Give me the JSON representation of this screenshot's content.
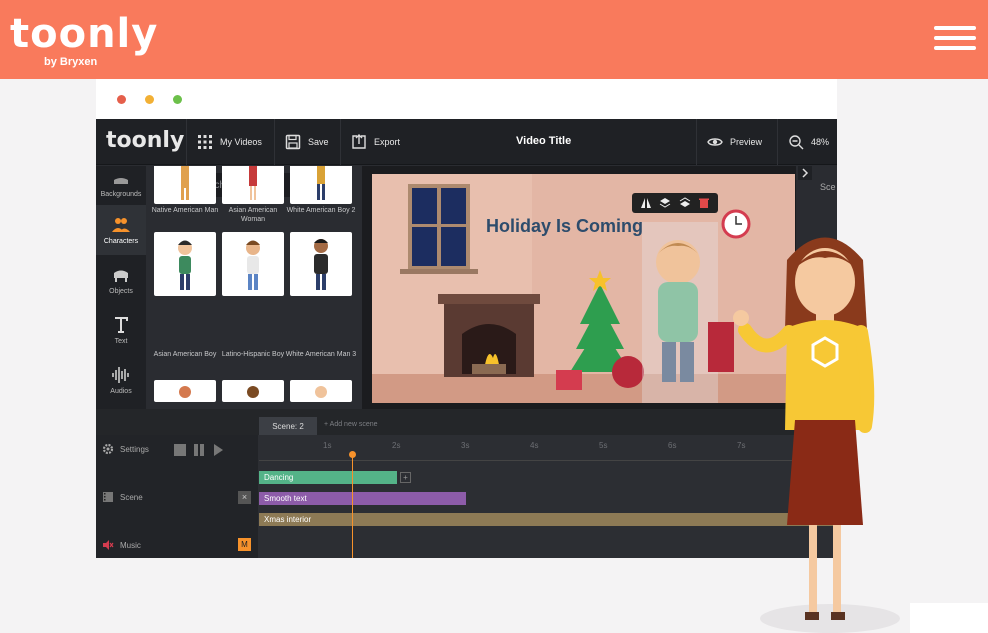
{
  "header": {
    "brand": "toonly",
    "brand_sub": "by Bryxen",
    "menu_icon": "hamburger-menu-icon"
  },
  "colors": {
    "header_bg": "#f97a5c",
    "dot_red": "#e55f4b",
    "dot_yellow": "#f2b035",
    "dot_green": "#6cc04a",
    "track_dancing": "#54b388",
    "track_smooth_text": "#8d5ca9",
    "track_xmas": "#8d7a55",
    "playhead": "#f7922b"
  },
  "app": {
    "logo": "toonly",
    "toolbar": {
      "my_videos": "My Videos",
      "save": "Save",
      "export": "Export",
      "video_title": "Video Title",
      "preview": "Preview",
      "zoom": "48%"
    },
    "sidebar": [
      {
        "label": "Backgrounds",
        "icon": "backgrounds-icon"
      },
      {
        "label": "Characters",
        "icon": "characters-icon"
      },
      {
        "label": "Objects",
        "icon": "objects-icon"
      },
      {
        "label": "Text",
        "icon": "text-icon"
      },
      {
        "label": "Audios",
        "icon": "audios-icon"
      }
    ],
    "search": {
      "placeholder": "Search characters..."
    },
    "characters": [
      {
        "label": "Native American Man"
      },
      {
        "label": "Asian American Woman"
      },
      {
        "label": "White American Boy 2"
      },
      {
        "label": "Asian American Boy"
      },
      {
        "label": "Latino-Hispanic Boy"
      },
      {
        "label": "White American Man 3"
      }
    ],
    "canvas_text": "Holiday Is Coming",
    "right_panel_label": "Sce",
    "timeline": {
      "scene_tab": "Scene: 2",
      "add_scene": "Add new scene",
      "settings": "Settings",
      "scene": "Scene",
      "music": "Music",
      "music_badge": "M",
      "ticks": [
        "1s",
        "2s",
        "3s",
        "4s",
        "5s",
        "6s",
        "7s"
      ],
      "tracks": [
        {
          "label": "Dancing"
        },
        {
          "label": "Smooth text"
        },
        {
          "label": "Xmas interior"
        }
      ]
    }
  }
}
